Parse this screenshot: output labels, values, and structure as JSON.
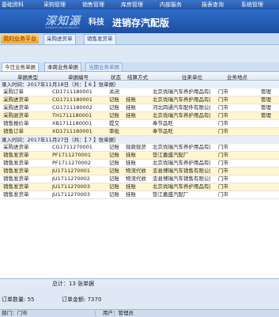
{
  "menu": [
    "基础资料",
    "采购管理",
    "销售管理",
    "库房管理",
    "内部服务",
    "报表查询",
    "系统管理"
  ],
  "brand": {
    "logo_main": "深知源",
    "logo_tech": "科技",
    "logo_sub": "SHENZHIYUAN TECHNOLOGY",
    "title": "进销存汽配版"
  },
  "nav": {
    "my_platform": "我的业务平台",
    "tabs": [
      "采购进货单",
      "销售发货单"
    ]
  },
  "tabs": [
    "今日业务单据",
    "本周业务单据",
    "当期业务单据"
  ],
  "columns": [
    "单据类型",
    "单据编号",
    "状态",
    "结算方式",
    "往来单位",
    "业务地点"
  ],
  "groups": [
    {
      "label": "录入时间：2017年11月18日（共：【 6 】张单据）",
      "rows": [
        [
          "采购订单",
          "CD1711180001",
          "关闭",
          "",
          "北京尚瑞汽车养护用品有|",
          "门市",
          "管理"
        ],
        [
          "采购进货单",
          "CG1711180001",
          "记账",
          "挂账",
          "北京尚瑞汽车养护用品有|",
          "门市",
          "管理"
        ],
        [
          "采购进货单",
          "CG1711180002",
          "记账",
          "挂账",
          "河北四通汽车配件有限公|",
          "门市",
          "管理"
        ],
        [
          "采购退货单",
          "TH1711180001",
          "记账",
          "挂账",
          "北京尚瑞汽车养护用品有|",
          "门市",
          "管理"
        ],
        [
          "销售报价单",
          "XB1711180001",
          "提交",
          "",
          "奉节品旺",
          "门市",
          ""
        ],
        [
          "销售订单",
          "XD1711180001",
          "审批",
          "",
          "奉节品旺",
          "门市",
          ""
        ]
      ]
    },
    {
      "label": "录入时间：2017年11月27日（共：【 7 】张单据）",
      "rows": [
        [
          "采购进货单",
          "CG1711270001",
          "记账",
          "现款现货",
          "北京尚瑞汽车养护用品有|",
          "门市",
          ""
        ],
        [
          "销售发货单",
          "PF1711270001",
          "记账",
          "挂账",
          "垫江嘉盛汽配厂",
          "门市",
          ""
        ],
        [
          "销售发货单",
          "PF1711270002",
          "记账",
          "挂账",
          "北京尚瑞汽车养护用品有|",
          "门市",
          ""
        ],
        [
          "销售发货单",
          "JU1711270001",
          "记账",
          "物流代收",
          "忠县博瑞汽车销售有限公|",
          "门市",
          ""
        ],
        [
          "销售发货单",
          "JU1711270002",
          "记账",
          "物流代收",
          "忠县博瑞汽车销售有限公|",
          "门市",
          ""
        ],
        [
          "销售发货单",
          "JU1711270003",
          "记账",
          "挂账",
          "北京尚瑞汽车养护用品有|",
          "门市",
          ""
        ],
        [
          "销售发货单",
          "JU1711270003",
          "记账",
          "挂账",
          "垫江嘉盛汽配厂",
          "门市",
          ""
        ]
      ]
    }
  ],
  "total": "总计：13 张单据",
  "summary": {
    "count": "订单数量: 55",
    "amount": "订单金额: 7370"
  },
  "status": {
    "dept": "部门：门市",
    "user": "用户：管理员"
  }
}
